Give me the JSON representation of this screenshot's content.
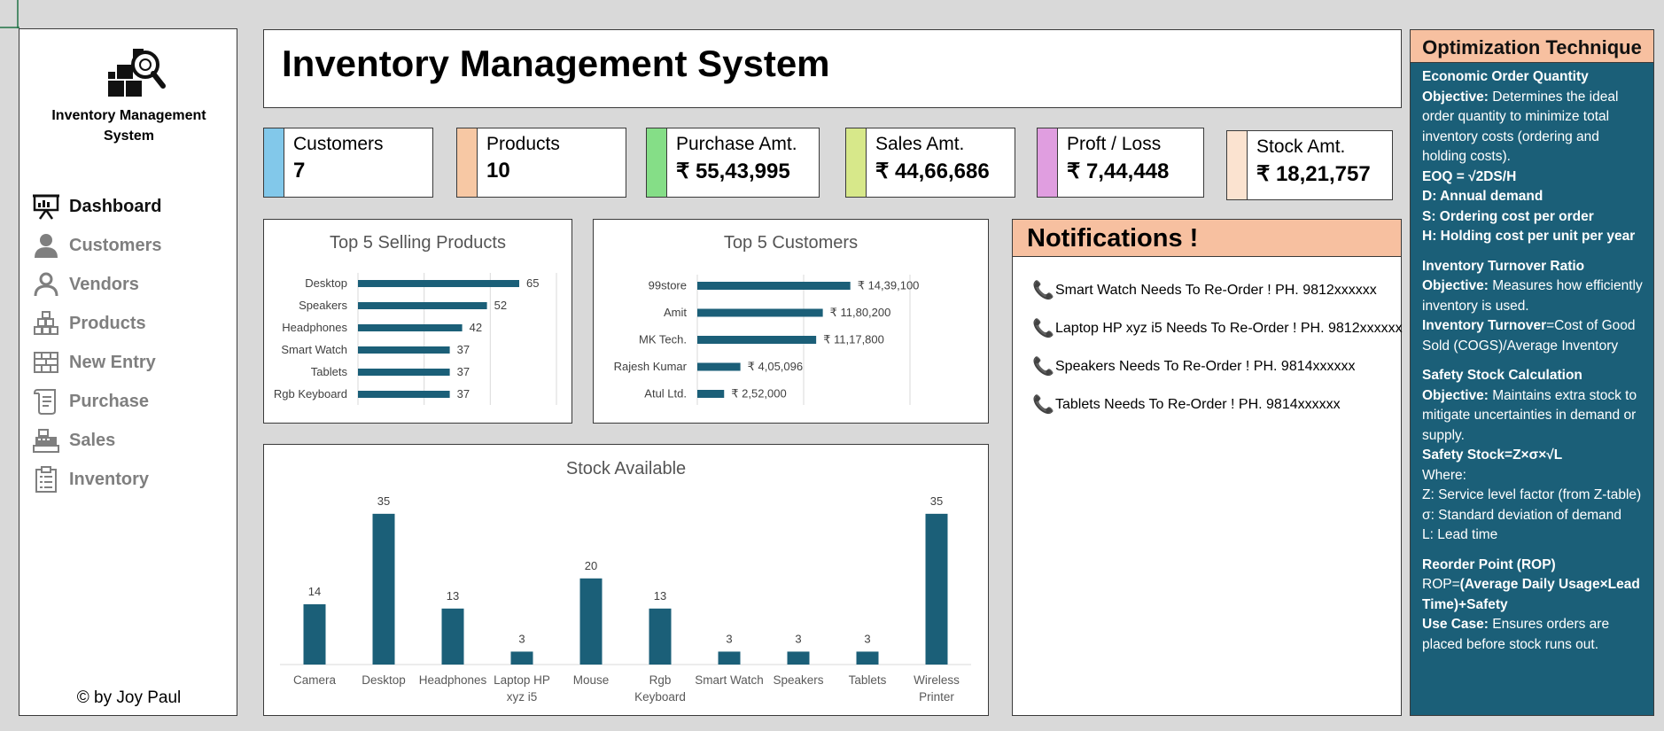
{
  "colors": {
    "bar": "#1b5f78",
    "customers": "#82c8ea",
    "products": "#f7c8a4",
    "purchase": "#85de87",
    "sales": "#d7e88a",
    "profit": "#e09ee0",
    "stock": "#fbe3d0"
  },
  "sidebar": {
    "brand": "Inventory Management\nSystem",
    "logo_icon": "inventory-magnifier-icon",
    "credit": "© by Joy Paul",
    "items": [
      {
        "label": "Dashboard",
        "icon": "presentation-icon",
        "active": true
      },
      {
        "label": "Customers",
        "icon": "person-icon"
      },
      {
        "label": "Vendors",
        "icon": "person-outline-icon"
      },
      {
        "label": "Products",
        "icon": "boxes-icon"
      },
      {
        "label": "New Entry",
        "icon": "brick-wall-icon"
      },
      {
        "label": "Purchase",
        "icon": "receipt-icon"
      },
      {
        "label": "Sales",
        "icon": "cash-register-icon"
      },
      {
        "label": "Inventory",
        "icon": "clipboard-icon"
      }
    ]
  },
  "header": {
    "title": "Inventory Management System"
  },
  "kpis": {
    "customers": {
      "label": "Customers",
      "value": "7"
    },
    "products": {
      "label": "Products",
      "value": "10"
    },
    "purchase": {
      "label": "Purchase Amt.",
      "value": "₹ 55,43,995"
    },
    "sales": {
      "label": "Sales Amt.",
      "value": "₹ 44,66,686"
    },
    "profit": {
      "label": "Proft / Loss",
      "value": "₹ 7,44,448"
    },
    "stock": {
      "label": "Stock Amt.",
      "value": "₹ 18,21,757"
    }
  },
  "chart_data": [
    {
      "type": "bar",
      "orientation": "horizontal",
      "title": "Top 5 Selling Products",
      "categories": [
        "Desktop",
        "Speakers",
        "Headphones",
        "Smart Watch",
        "Tablets",
        "Rgb Keyboard"
      ],
      "values": [
        65,
        52,
        42,
        37,
        37,
        37
      ],
      "labels": [
        "65",
        "52",
        "42",
        "37",
        "37",
        "37"
      ],
      "xlim": [
        0,
        80
      ]
    },
    {
      "type": "bar",
      "orientation": "horizontal",
      "title": "Top 5 Customers",
      "categories": [
        "99store",
        "Amit",
        "MK Tech.",
        "Rajesh Kumar",
        "Atul Ltd."
      ],
      "values": [
        1439100,
        1180200,
        1117800,
        405096,
        252000
      ],
      "labels": [
        "₹ 14,39,100",
        "₹ 11,80,200",
        "₹ 11,17,800",
        "₹ 4,05,096",
        "₹ 2,52,000"
      ],
      "xlim": [
        0,
        3000000
      ]
    },
    {
      "type": "bar",
      "orientation": "vertical",
      "title": "Stock Available",
      "categories": [
        "Camera",
        "Desktop",
        "Headphones",
        "Laptop HP xyz i5",
        "Mouse",
        "Rgb Keyboard",
        "Smart Watch",
        "Speakers",
        "Tablets",
        "Wireless Printer"
      ],
      "values": [
        14,
        35,
        13,
        3,
        20,
        13,
        3,
        3,
        3,
        35
      ],
      "ylim": [
        0,
        36
      ]
    }
  ],
  "notifications": {
    "title": "Notifications !",
    "items": [
      "Smart Watch Needs To Re-Order ! PH. 9812xxxxxx",
      "Laptop HP xyz i5 Needs To Re-Order ! PH. 9812xxxxxx",
      "Speakers Needs To Re-Order ! PH. 9814xxxxxx",
      "Tablets Needs To Re-Order ! PH. 9814xxxxxx"
    ]
  },
  "optimization": {
    "title": "Optimization Technique",
    "eoq": {
      "heading": "Economic Order Quantity",
      "objective_label": "Objective:",
      "objective": " Determines the ideal order quantity to minimize total inventory costs (ordering and holding costs).",
      "formula": "EOQ = √2DS/H",
      "d": "D: Annual demand",
      "s": "S: Ordering cost per order",
      "h": "H: Holding cost per unit per year"
    },
    "turnover": {
      "heading": "Inventory Turnover Ratio",
      "objective_label": "Objective:",
      "objective": " Measures how efficiently inventory is used.",
      "formula_label": "Inventory Turnover",
      "formula": "=Cost of Good Sold (COGS)/Average Inventory"
    },
    "safety": {
      "heading": "Safety Stock Calculation",
      "objective_label": "Objective:",
      "objective": " Maintains extra stock to mitigate uncertainties in demand or supply.",
      "formula": "Safety Stock=Z×σ×√L",
      "where": "Where:",
      "z": "Z: Service level factor (from Z-table)",
      "sigma": "σ: Standard deviation of demand",
      "l": "L: Lead time"
    },
    "rop": {
      "heading": "Reorder Point (ROP)",
      "formula_prefix": "ROP=",
      "formula": "(Average Daily Usage×Lead Time)+Safety",
      "usecase_label": "Use Case:",
      "usecase": " Ensures orders are placed before stock runs out."
    }
  }
}
